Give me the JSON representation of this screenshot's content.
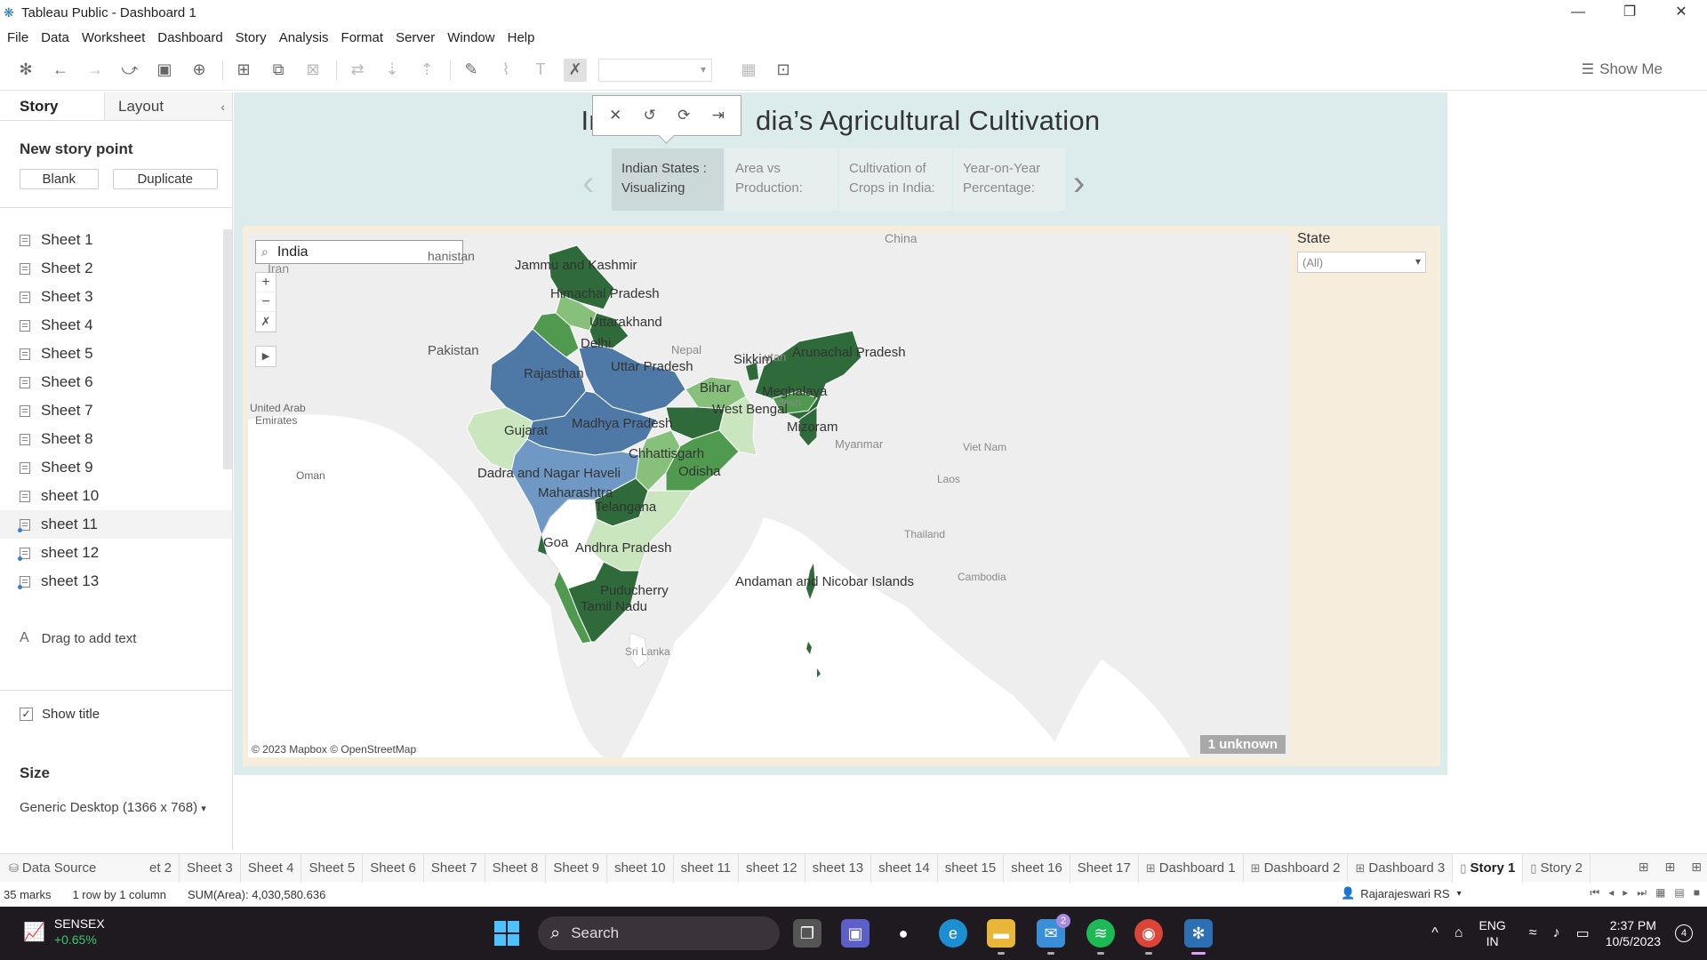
{
  "window": {
    "title": "Tableau Public - Dashboard 1",
    "minimize": "—",
    "maximize": "❐",
    "close": "✕"
  },
  "menu": [
    "File",
    "Data",
    "Worksheet",
    "Dashboard",
    "Story",
    "Analysis",
    "Format",
    "Server",
    "Window",
    "Help"
  ],
  "toolbar": {
    "show_me": "Show Me"
  },
  "left_panel": {
    "tab_story": "Story",
    "tab_layout": "Layout",
    "new_story_point": "New story point",
    "blank": "Blank",
    "duplicate": "Duplicate",
    "sheets": [
      "Sheet 1",
      "Sheet 2",
      "Sheet 3",
      "Sheet 4",
      "Sheet 5",
      "Sheet 6",
      "Sheet 7",
      "Sheet 8",
      "Sheet 9",
      "sheet 10",
      "sheet 11",
      "sheet 12",
      "sheet 13"
    ],
    "drag_text": "Drag to add text",
    "show_title": "Show title",
    "size_title": "Size",
    "size_value": "Generic Desktop (1366 x 768)"
  },
  "story": {
    "title_left": "In",
    "title_right": "dia’s Agricultural Cultivation",
    "points": [
      {
        "line1": "Indian States :",
        "line2": "Visualizing"
      },
      {
        "line1": "Area vs",
        "line2": "Production:"
      },
      {
        "line1": "Cultivation of",
        "line2": "Crops in India:"
      },
      {
        "line1": "Year-on-Year",
        "line2": "Percentage:"
      }
    ]
  },
  "map": {
    "search_value": "India",
    "credit": "© 2023 Mapbox © OpenStreetMap",
    "unknown": "1 unknown",
    "state_labels": {
      "jk": "Jammu and Kashmir",
      "hp": "Himachal Pradesh",
      "uk": "Uttarakhand",
      "delhi": "Delhi",
      "raj": "Rajasthan",
      "up": "Uttar Pradesh",
      "bihar": "Bihar",
      "wb": "West Bengal",
      "sikkim": "Sikkim",
      "arunachal": "Arunachal Pradesh",
      "meghalaya": "Meghalaya",
      "mizoram": "Mizoram",
      "gujarat": "Gujarat",
      "mp": "Madhya Pradesh",
      "chh": "Chhattisgarh",
      "odisha": "Odisha",
      "dnh": "Dadra and Nagar Haveli",
      "maha": "Maharashtra",
      "tel": "Telangana",
      "goa": "Goa",
      "ap": "Andhra Pradesh",
      "pud": "Puducherry",
      "tn": "Tamil Nadu",
      "an": "Andaman and Nicobar Islands"
    },
    "base_labels": {
      "china": "China",
      "afg": "hanistan",
      "iran": "Iran",
      "pakistan": "Pakistan",
      "nepal": "Nepal",
      "bhutan": "utan",
      "uae1": "United Arab",
      "uae2": "Emirates",
      "oman": "Oman",
      "myanmar": "Myanmar",
      "vietnam": "Viet Nam",
      "laos": "Laos",
      "thailand": "Thailand",
      "cambodia": "Cambodia",
      "srilanka": "Sri Lanka",
      "bangla": "desh"
    },
    "colors": {
      "dark_green": "#2f6b3a",
      "mid_green": "#4f9a4f",
      "light_green": "#86c07a",
      "pale_green": "#c9e6bf",
      "blue": "#4e79a7",
      "light_blue": "#6f98c4"
    }
  },
  "filter": {
    "title": "State",
    "value": "(All)"
  },
  "tabs": [
    {
      "label": "Data Source",
      "icon": "⛁"
    },
    {
      "label": "et 2"
    },
    {
      "label": "Sheet 3"
    },
    {
      "label": "Sheet 4"
    },
    {
      "label": "Sheet 5"
    },
    {
      "label": "Sheet 6"
    },
    {
      "label": "Sheet 7"
    },
    {
      "label": "Sheet 8"
    },
    {
      "label": "Sheet 9"
    },
    {
      "label": "sheet 10"
    },
    {
      "label": "sheet 11"
    },
    {
      "label": "sheet 12"
    },
    {
      "label": "sheet 13"
    },
    {
      "label": "sheet 14"
    },
    {
      "label": "sheet 15"
    },
    {
      "label": "sheet 16"
    },
    {
      "label": "Sheet 17"
    },
    {
      "label": "Dashboard 1",
      "icon": "⊞"
    },
    {
      "label": "Dashboard 2",
      "icon": "⊞"
    },
    {
      "label": "Dashboard 3",
      "icon": "⊞"
    },
    {
      "label": "Story 1",
      "icon": "▯"
    },
    {
      "label": "Story 2",
      "icon": "▯"
    }
  ],
  "status": {
    "marks": "35 marks",
    "rows": "1 row by 1 column",
    "sum": "SUM(Area): 4,030,580.636",
    "user": "Rajarajeswari RS"
  },
  "taskbar": {
    "stock_name": "SENSEX",
    "stock_change": "+0.65%",
    "search": "Search",
    "mail_badge": "2",
    "lang1": "ENG",
    "lang2": "IN",
    "time": "2:37 PM",
    "date": "10/5/2023",
    "notifications": "4"
  }
}
